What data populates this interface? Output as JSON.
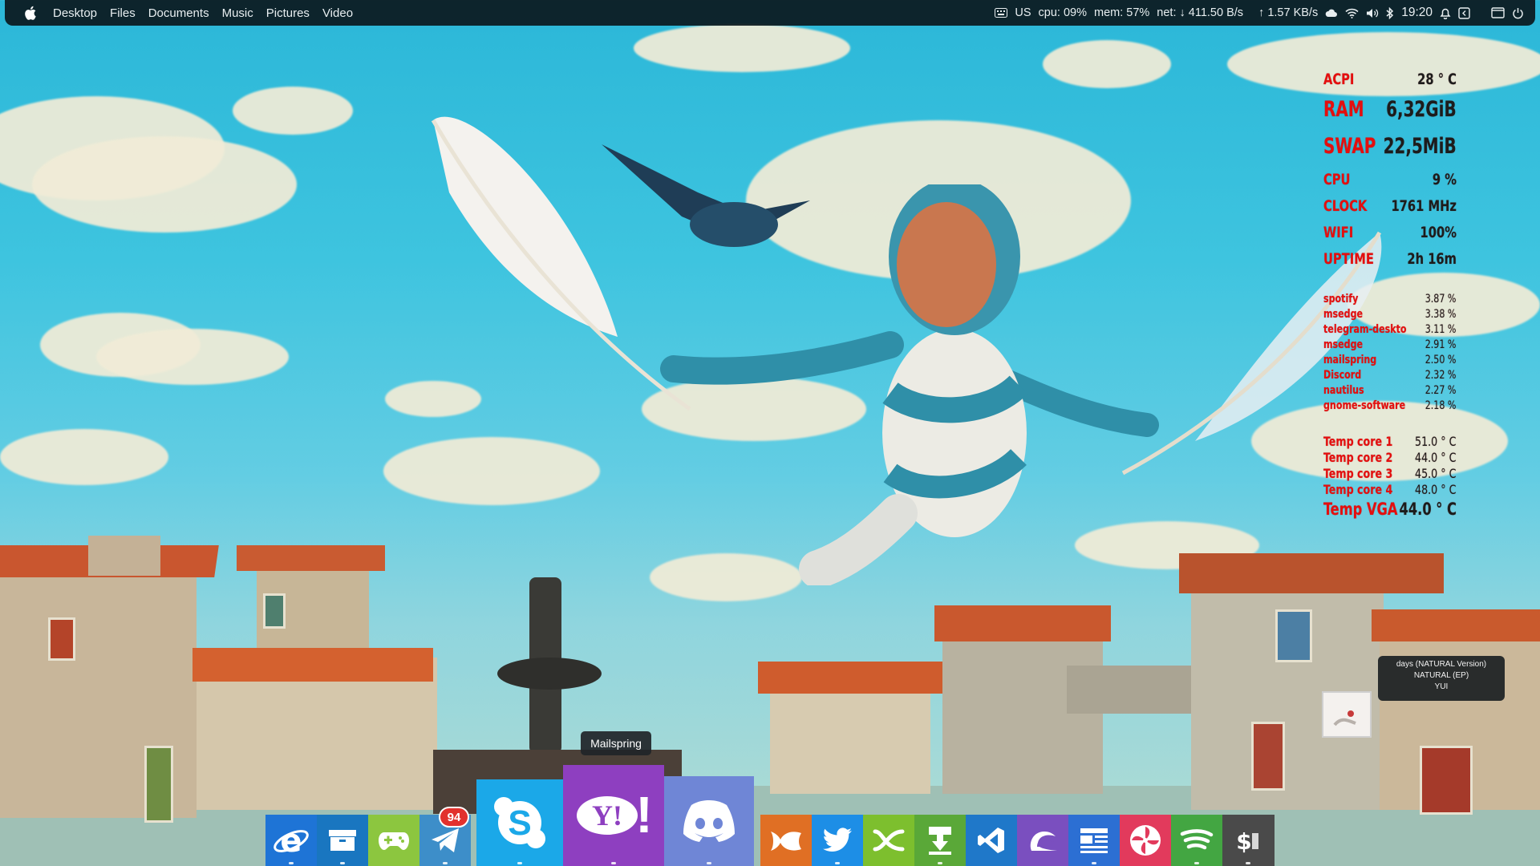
{
  "menubar": {
    "apple_icon": "apple-logo-icon",
    "items": [
      "Desktop",
      "Files",
      "Documents",
      "Music",
      "Pictures",
      "Video"
    ]
  },
  "tray": {
    "keyboard_layout": "US",
    "cpu": "cpu: 09%",
    "mem": "mem: 57%",
    "net_down": "net: ↓  411.50 B/s",
    "net_up": "↑  1.57 KB/s",
    "clock": "19:20",
    "icons": [
      "keyboard-icon",
      "cloud-icon",
      "wifi-icon",
      "volume-icon",
      "bluetooth-icon",
      "bell-icon",
      "back-icon",
      "window-icon",
      "power-icon"
    ]
  },
  "conky": {
    "acpi": {
      "label": "ACPI",
      "value": "28 ° C"
    },
    "ram": {
      "label": "RAM",
      "value": "6,32GiB"
    },
    "swap": {
      "label": "SWAP",
      "value": "22,5MiB"
    },
    "cpu": {
      "label": "CPU",
      "value": "9 %"
    },
    "clock": {
      "label": "CLOCK",
      "value": "1761 MHz"
    },
    "wifi": {
      "label": "WIFI",
      "value": "100%"
    },
    "uptime": {
      "label": "UPTIME",
      "value": "2h 16m"
    },
    "processes": [
      {
        "name": "spotify",
        "value": "3.87 %"
      },
      {
        "name": "msedge",
        "value": "3.38 %"
      },
      {
        "name": "telegram-deskto",
        "value": "3.11 %"
      },
      {
        "name": "msedge",
        "value": "2.91 %"
      },
      {
        "name": "mailspring",
        "value": "2.50 %"
      },
      {
        "name": "Discord",
        "value": "2.32 %"
      },
      {
        "name": "nautilus",
        "value": "2.27 %"
      },
      {
        "name": "gnome-software",
        "value": "2.18 %"
      }
    ],
    "temps": [
      {
        "name": "Temp core 1",
        "value": "51.0 ° C"
      },
      {
        "name": "Temp core 2",
        "value": "44.0 ° C"
      },
      {
        "name": "Temp core 3",
        "value": "45.0 ° C"
      },
      {
        "name": "Temp core 4",
        "value": "48.0 ° C"
      }
    ],
    "temp_vga": {
      "name": "Temp VGA",
      "value": "44.0 ° C"
    }
  },
  "music": {
    "title": "days (NATURAL Version)",
    "album": "NATURAL (EP)",
    "artist": "YUI"
  },
  "dock": {
    "tooltip": "Mailspring",
    "telegram_badge": "94",
    "apps": [
      {
        "name": "internet-explorer",
        "icon": "ie-icon",
        "color": "#1e74d6"
      },
      {
        "name": "archive-manager",
        "icon": "archive-icon",
        "color": "#1976c0"
      },
      {
        "name": "games",
        "icon": "gamepad-icon",
        "color": "#8cc63f"
      },
      {
        "name": "telegram",
        "icon": "telegram-icon",
        "color": "#3d8ec9"
      },
      {
        "name": "skype",
        "icon": "skype-icon",
        "color": "#1ba8e8"
      },
      {
        "name": "mailspring",
        "icon": "yahoo-icon",
        "color": "#8e3fc0"
      },
      {
        "name": "discord",
        "icon": "discord-icon",
        "color": "#6f86d6"
      },
      {
        "name": "gnome-software",
        "icon": "fish-icon",
        "color": "#e06f24"
      },
      {
        "name": "twitter",
        "icon": "twitter-icon",
        "color": "#1d8ee6"
      },
      {
        "name": "crossover",
        "icon": "crossover-icon",
        "color": "#7dbf2e"
      },
      {
        "name": "updater",
        "icon": "download-icon",
        "color": "#5aa838"
      },
      {
        "name": "vscode",
        "icon": "vscode-icon",
        "color": "#1f78c9"
      },
      {
        "name": "gnome-builder",
        "icon": "wave-icon",
        "color": "#7a4fbf"
      },
      {
        "name": "news",
        "icon": "news-icon",
        "color": "#2c6fd3"
      },
      {
        "name": "pinwheel",
        "icon": "pinwheel-icon",
        "color": "#e23a5c"
      },
      {
        "name": "spotify",
        "icon": "spotify-icon",
        "color": "#43a642"
      },
      {
        "name": "terminal",
        "icon": "terminal-icon",
        "color": "#4a4a4a"
      }
    ]
  }
}
